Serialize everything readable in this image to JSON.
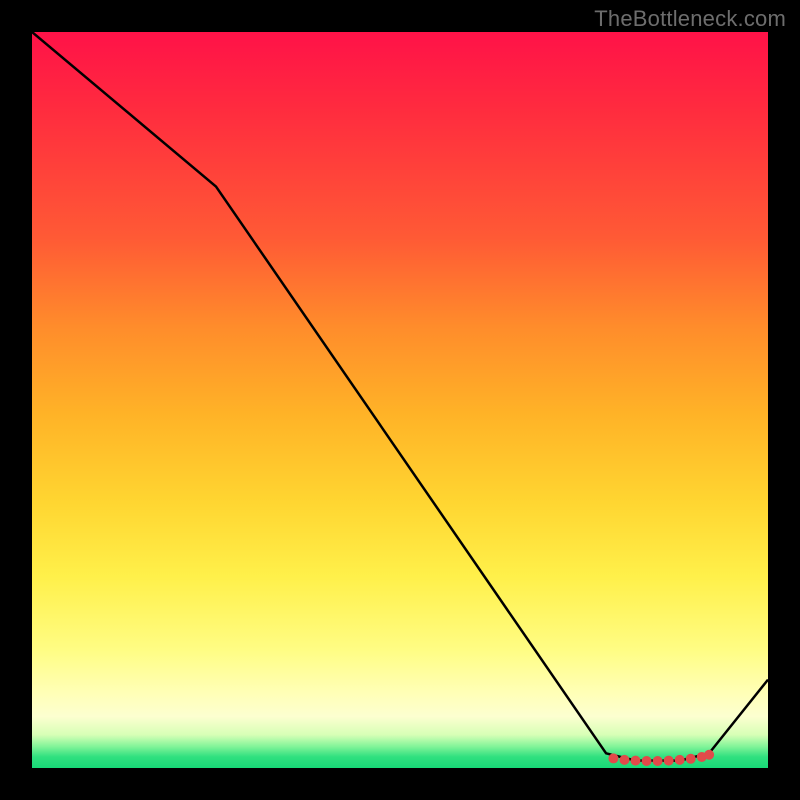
{
  "attribution": "TheBottleneck.com",
  "chart_data": {
    "type": "line",
    "title": "",
    "xlabel": "",
    "ylabel": "",
    "xlim": [
      0,
      100
    ],
    "ylim": [
      0,
      100
    ],
    "grid": false,
    "legend": false,
    "annotations": [],
    "series": [
      {
        "name": "curve",
        "x": [
          0,
          25,
          78,
          82,
          88,
          92,
          100
        ],
        "values": [
          100,
          79,
          2,
          1,
          1,
          2,
          12
        ]
      }
    ],
    "markers": {
      "name": "highlight-dots",
      "x": [
        79,
        80.5,
        82,
        83.5,
        85,
        86.5,
        88,
        89.5,
        91,
        92
      ],
      "values": [
        1.3,
        1.1,
        1.0,
        0.95,
        0.95,
        1.0,
        1.1,
        1.25,
        1.5,
        1.8
      ],
      "color": "#e24a4a"
    },
    "background_gradient": {
      "direction": "vertical",
      "stops": [
        {
          "pos": 0.0,
          "color": "#ff1248"
        },
        {
          "pos": 0.28,
          "color": "#ff5a35"
        },
        {
          "pos": 0.52,
          "color": "#ffb327"
        },
        {
          "pos": 0.74,
          "color": "#fff04a"
        },
        {
          "pos": 0.93,
          "color": "#fcffd0"
        },
        {
          "pos": 0.97,
          "color": "#86f59a"
        },
        {
          "pos": 1.0,
          "color": "#18d977"
        }
      ]
    }
  }
}
